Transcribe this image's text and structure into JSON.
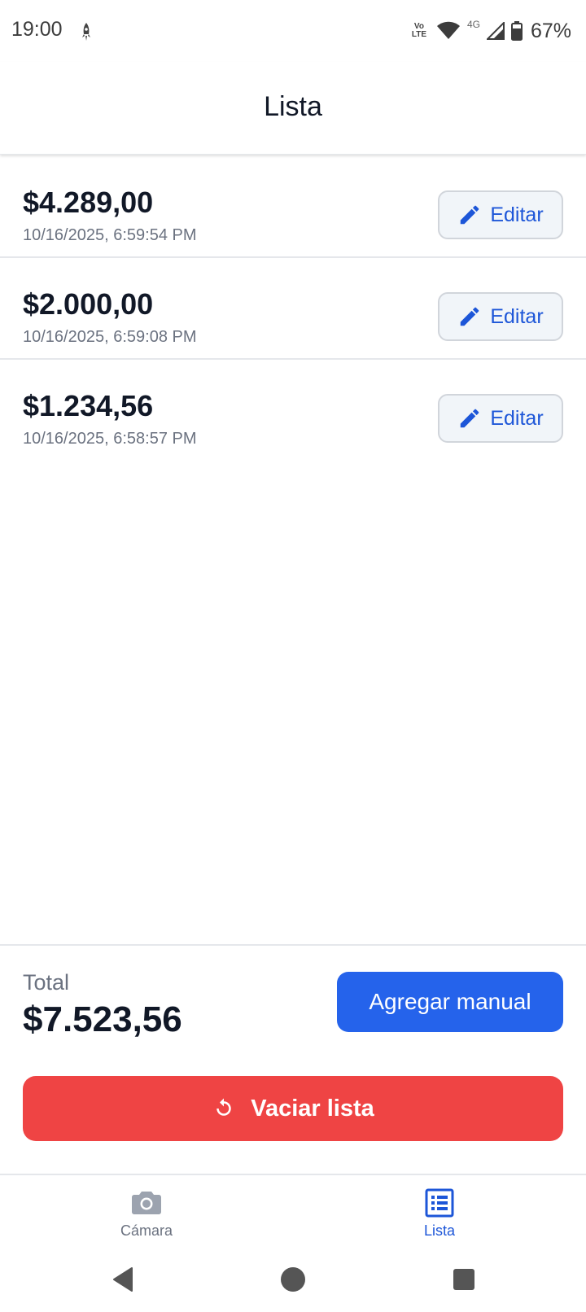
{
  "status_bar": {
    "time": "19:00",
    "volte_top": "Vo",
    "volte_bottom": "LTE",
    "network": "4G",
    "battery": "67%"
  },
  "header": {
    "title": "Lista"
  },
  "items": [
    {
      "amount": "$4.289,00",
      "timestamp": "10/16/2025, 6:59:54 PM",
      "edit_label": "Editar"
    },
    {
      "amount": "$2.000,00",
      "timestamp": "10/16/2025, 6:59:08 PM",
      "edit_label": "Editar"
    },
    {
      "amount": "$1.234,56",
      "timestamp": "10/16/2025, 6:58:57 PM",
      "edit_label": "Editar"
    }
  ],
  "summary": {
    "total_label": "Total",
    "total_value": "$7.523,56",
    "add_manual_label": "Agregar manual",
    "clear_label": "Vaciar lista"
  },
  "bottom_nav": {
    "items": [
      {
        "label": "Cámara",
        "icon": "camera-icon",
        "active": false
      },
      {
        "label": "Lista",
        "icon": "list-icon",
        "active": true
      }
    ]
  },
  "colors": {
    "primary": "#2563eb",
    "danger": "#ef4444",
    "text": "#111827",
    "muted": "#6b7280"
  }
}
